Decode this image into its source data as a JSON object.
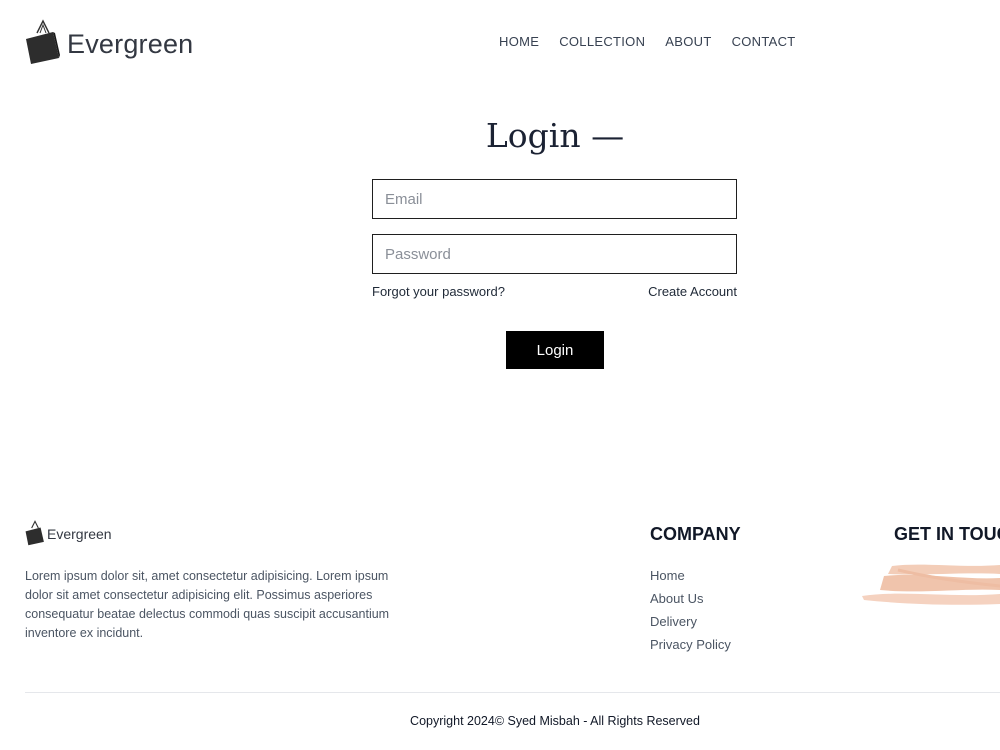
{
  "brand": {
    "name": "Evergreen",
    "icon": "shopping-bag-icon"
  },
  "nav": [
    {
      "label": "HOME"
    },
    {
      "label": "COLLECTION"
    },
    {
      "label": "ABOUT"
    },
    {
      "label": "CONTACT"
    }
  ],
  "login": {
    "title": "Login —",
    "email_placeholder": "Email",
    "email_value": "",
    "password_placeholder": "Password",
    "password_value": "",
    "forgot_label": "Forgot your password?",
    "create_label": "Create Account",
    "submit_label": "Login"
  },
  "footer": {
    "brand": "Evergreen",
    "description": "Lorem ipsum dolor sit, amet consectetur adipisicing. Lorem ipsum dolor sit amet consectetur adipisicing elit. Possimus asperiores consequatur beatae delectus commodi quas suscipit accusantium inventore ex incidunt.",
    "company_heading": "COMPANY",
    "company_links": [
      "Home",
      "About Us",
      "Delivery",
      "Privacy Policy"
    ],
    "touch_heading": "GET IN TOUCH",
    "redaction_color": "#f3cdb8",
    "copyright": "Copyright 2024© Syed Misbah - All Rights Reserved"
  },
  "colors": {
    "accent": "#000000",
    "title": "#1b2233",
    "text": "#1f2937"
  }
}
